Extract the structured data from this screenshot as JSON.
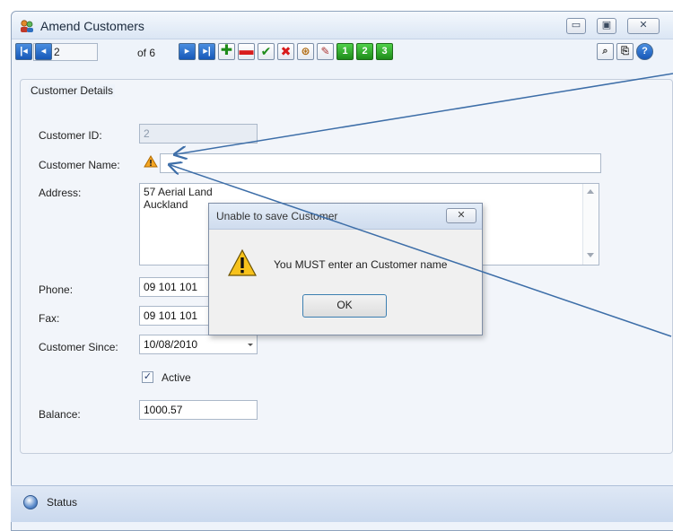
{
  "window": {
    "title": "Amend Customers",
    "minimize": "▭",
    "maximize": "▣",
    "close": "✕"
  },
  "navigator": {
    "record": "2",
    "of_text": "of 6"
  },
  "form": {
    "section_title": "Customer Details",
    "customer_id": {
      "label": "Customer ID:",
      "value": "2"
    },
    "customer_name": {
      "label": "Customer Name:",
      "value": ""
    },
    "address": {
      "label": "Address:",
      "value": "57 Aerial Land\nAuckland"
    },
    "phone": {
      "label": "Phone:",
      "value": "09 101 101"
    },
    "fax": {
      "label": "Fax:",
      "value": "09 101 101"
    },
    "customer_since": {
      "label": "Customer Since:",
      "value": "10/08/2010"
    },
    "active": {
      "label": "Active",
      "checked": true
    },
    "balance": {
      "label": "Balance:",
      "value": "1000.57"
    }
  },
  "status": {
    "label": "Status"
  },
  "dialog": {
    "title": "Unable to save Customer",
    "message": "You MUST enter an Customer name",
    "ok": "OK",
    "close": "✕"
  },
  "colors": {
    "nav_blue": "#1658b8",
    "add_green": "#1e8b1a",
    "delete_red": "#d81c1c",
    "callout_line": "#3d6ea8"
  }
}
